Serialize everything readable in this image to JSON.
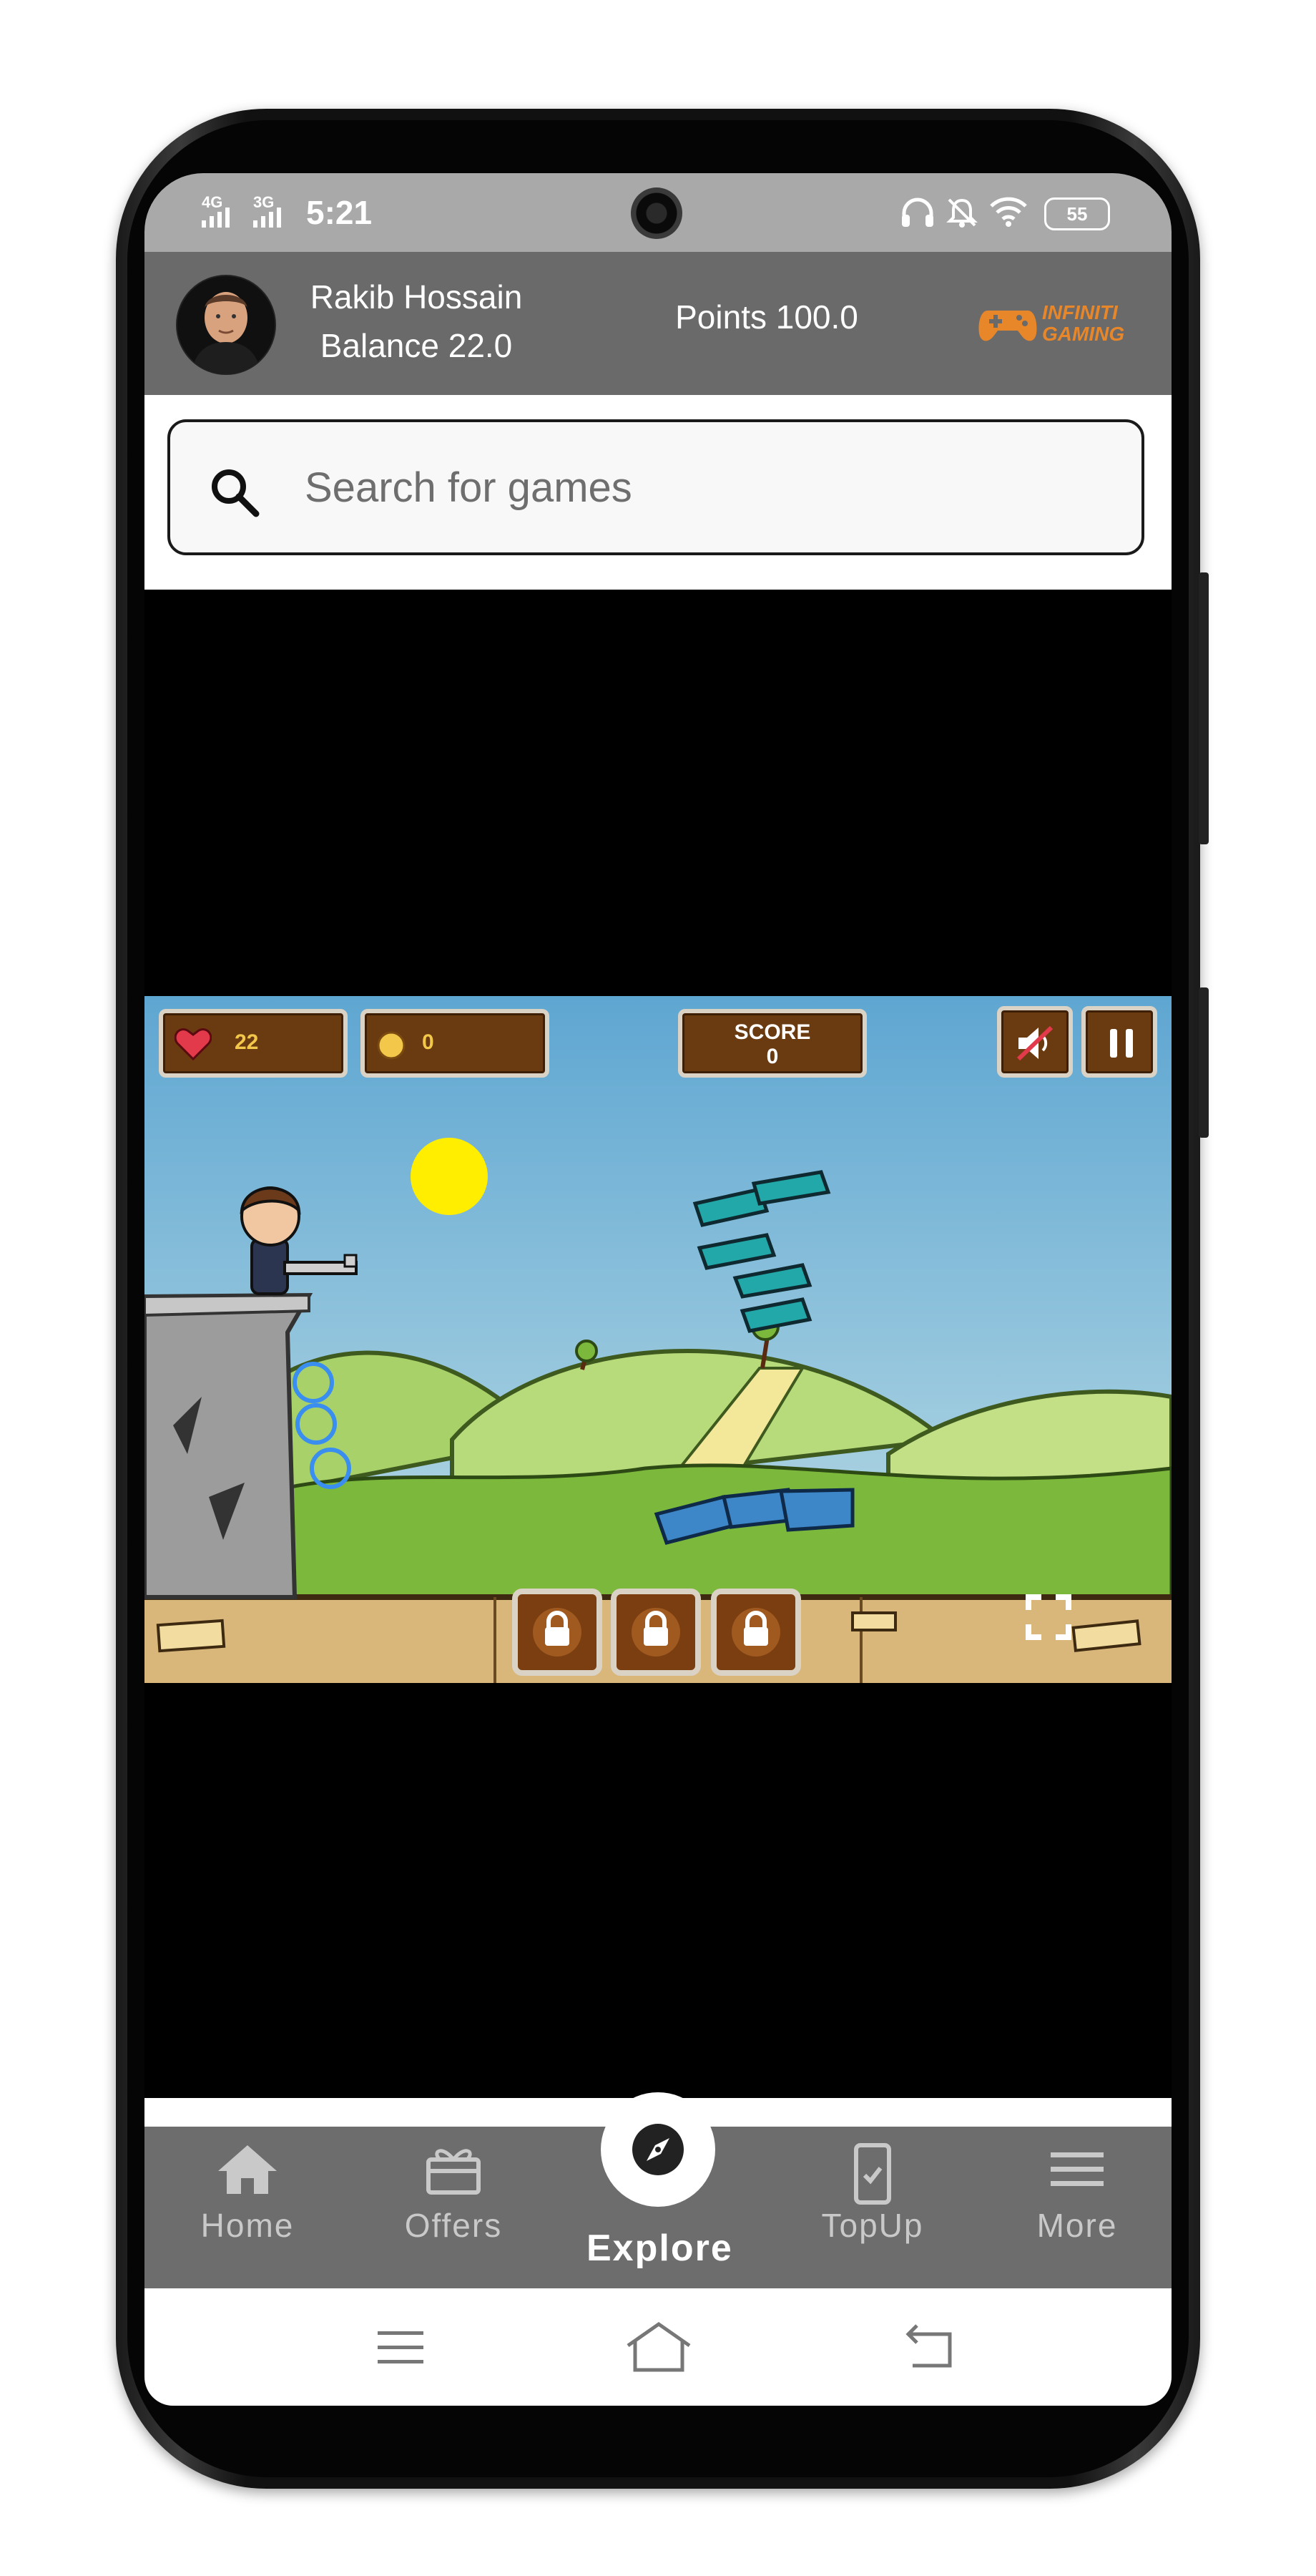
{
  "status_bar": {
    "signal_1": "4G",
    "signal_2": "3G",
    "time": "5:21",
    "battery": "55"
  },
  "header": {
    "user_name": "Rakib Hossain",
    "balance": "Balance 22.0",
    "points": "Points 100.0",
    "brand_line1": "INFINITI",
    "brand_line2": "GAMING"
  },
  "search": {
    "placeholder": "Search for games"
  },
  "game": {
    "lives": "22",
    "coins": "0",
    "score_label": "SCORE",
    "score_value": "0"
  },
  "bottom_nav": {
    "items": [
      {
        "label": "Home",
        "icon": "home-icon"
      },
      {
        "label": "Offers",
        "icon": "gift-icon"
      },
      {
        "label": "Explore",
        "icon": "compass-icon",
        "active": true
      },
      {
        "label": "TopUp",
        "icon": "phone-topup-icon"
      },
      {
        "label": "More",
        "icon": "menu-icon"
      }
    ]
  },
  "colors": {
    "header_bg": "#6a6a6a",
    "nav_bg": "#6d6d6d",
    "brand": "#e8862a",
    "status_bg": "#a9a9a9"
  }
}
